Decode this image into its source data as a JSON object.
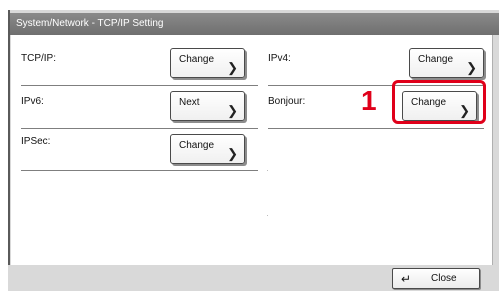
{
  "window": {
    "title": "System/Network - TCP/IP Setting"
  },
  "settings": [
    {
      "label": "TCP/IP:",
      "button": "Change"
    },
    {
      "label": "IPv4:",
      "button": "Change"
    },
    {
      "label": "IPv6:",
      "button": "Next"
    },
    {
      "label": "Bonjour:",
      "button": "Change"
    },
    {
      "label": "IPSec:",
      "button": "Change"
    }
  ],
  "callout": {
    "number": "1",
    "color": "#e0001a"
  },
  "footer": {
    "close_label": "Close"
  },
  "icons": {
    "chevron": "chevron-right-icon",
    "return": "return-arrow-icon"
  }
}
